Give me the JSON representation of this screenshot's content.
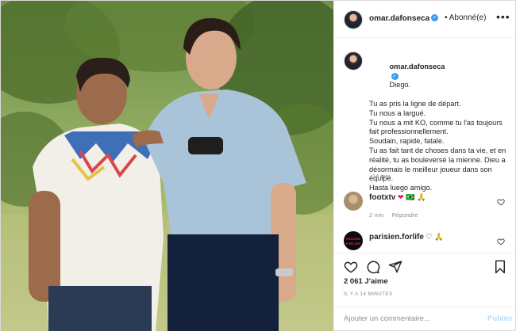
{
  "post": {
    "photo_alt": "",
    "author": {
      "username": "omar.dafonseca",
      "verified_icon": "verified-badge-icon",
      "follow_label": "• Abonné(e)",
      "more_icon": "more-options-icon",
      "more_label": "•••"
    },
    "caption": {
      "username": "omar.dafonseca",
      "lines": [
        "Diego.",
        "Tu as pris la ligne de départ.",
        "Tu nous a largué.",
        "Tu nous a mit KO, comme tu l'as toujours fait professionnellement.",
        "Soudain, rapide, fatale.",
        "Tu as fait tant de choses dans ta vie, et en réalité, tu as bouleversé la mienne. Dieu a désormais le meilleur joueur dans son équipe.",
        "Hasta luego amigo."
      ],
      "time": "14 min"
    },
    "comments": [
      {
        "username": "footxtv",
        "text": "❤ 🇧🇷 🙏",
        "time": "2 min",
        "reply_label": "Répondre",
        "like_icon": "heart-outline-icon"
      },
      {
        "username": "parisien.forlife",
        "text": "♡ 🙏",
        "avatar_text": "PASSION FOR LIFE",
        "like_icon": "heart-outline-icon"
      }
    ],
    "actions": {
      "like_icon": "heart-icon",
      "comment_icon": "comment-bubble-icon",
      "share_icon": "paper-plane-icon",
      "save_icon": "bookmark-icon"
    },
    "likes": "2 061 J'aime",
    "posted_ago": "IL Y A 14 MINUTES",
    "add_comment": {
      "placeholder": "Ajouter un commentaire...",
      "publish_label": "Publier"
    },
    "colors": {
      "accent": "#3897f0",
      "publish_disabled": "#b2dffc",
      "muted": "#8e8e8e",
      "text": "#262626",
      "border": "#dbdbdb"
    }
  }
}
